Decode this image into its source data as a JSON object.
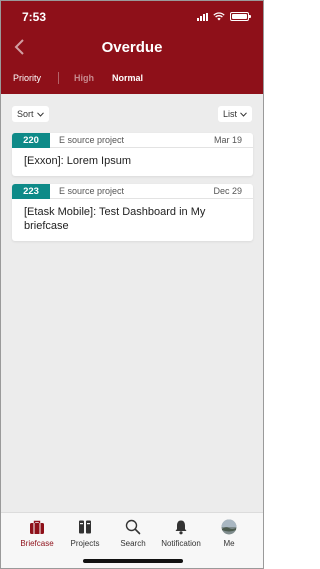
{
  "status_bar": {
    "time": "7:53"
  },
  "header": {
    "title": "Overdue"
  },
  "filters": {
    "label": "Priority",
    "tabs": [
      "High",
      "Normal"
    ]
  },
  "controls": {
    "sort": "Sort",
    "view": "List"
  },
  "cards": [
    {
      "id": "220",
      "project": "E source project",
      "date": "Mar 19",
      "title": "[Exxon]: Lorem Ipsum"
    },
    {
      "id": "223",
      "project": "E source project",
      "date": "Dec 29",
      "title": "[Etask Mobile]: Test Dashboard in My briefcase"
    }
  ],
  "tabbar": [
    "Briefcase",
    "Projects",
    "Search",
    "Notification",
    "Me"
  ],
  "colors": {
    "brand": "#8e1019",
    "badge": "#0e8a88",
    "background": "#ececec"
  }
}
